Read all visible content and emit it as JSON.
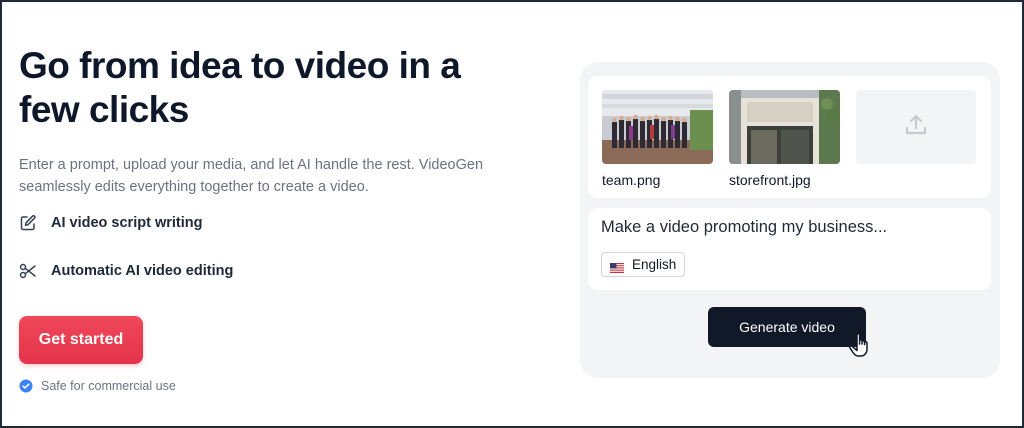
{
  "hero": {
    "headline": "Go from idea to video in a few clicks",
    "subtitle": "Enter a prompt, upload your media, and let AI handle the rest. VideoGen seamlessly edits everything together to create a video."
  },
  "features": [
    {
      "icon": "pencil-square-icon",
      "label": "AI video script writing"
    },
    {
      "icon": "scissors-icon",
      "label": "Automatic AI video editing"
    }
  ],
  "cta": {
    "label": "Get started"
  },
  "safe": {
    "icon": "check-badge-icon",
    "label": "Safe for commercial use"
  },
  "composer": {
    "files": [
      {
        "name": "team.png"
      },
      {
        "name": "storefront.jpg"
      }
    ],
    "upload_icon": "upload-icon",
    "prompt": "Make a video promoting my business...",
    "language": {
      "flag": "us-flag-icon",
      "label": "English"
    },
    "generate_label": "Generate video",
    "cursor_icon": "hand-pointer-icon"
  },
  "colors": {
    "cta": "#e4334a",
    "generate_button": "#111827",
    "panel_bg": "#f3f4f6",
    "badge_blue": "#3b82f6"
  }
}
